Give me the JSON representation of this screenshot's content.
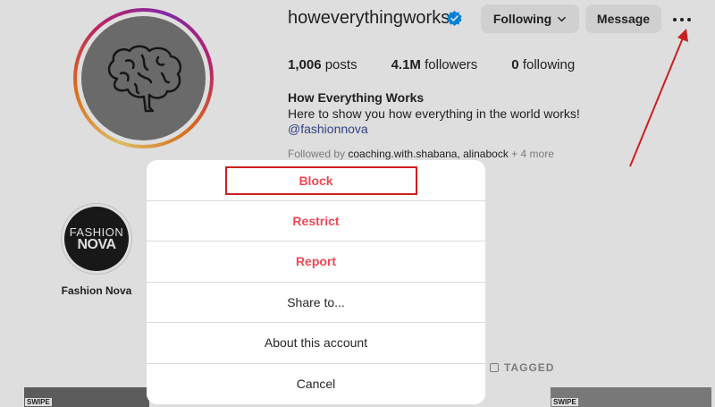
{
  "profile": {
    "username": "howeverythingworks",
    "following_button": "Following",
    "message_button": "Message",
    "stats": [
      {
        "value": "1,006",
        "label": "posts"
      },
      {
        "value": "4.1M",
        "label": "followers"
      },
      {
        "value": "0",
        "label": "following"
      }
    ],
    "bio": {
      "name": "How Everything Works",
      "text": "Here to show you how everything in the world works!",
      "link": "@fashionnova"
    },
    "followed_by": {
      "prefix": "Followed by ",
      "users": "coaching.with.shabana, alinabock",
      "more": " + 4 more"
    },
    "highlight": {
      "label": "Fashion Nova",
      "logo_line1": "FASHION",
      "logo_line2": "NOVA"
    },
    "tabs": {
      "tagged": "TAGGED"
    },
    "thumb_badge": "SWIPE"
  },
  "dialog": {
    "items": [
      {
        "label": "Block",
        "style": "danger"
      },
      {
        "label": "Restrict",
        "style": "danger"
      },
      {
        "label": "Report",
        "style": "danger"
      },
      {
        "label": "Share to...",
        "style": "normal"
      },
      {
        "label": "About this account",
        "style": "normal"
      },
      {
        "label": "Cancel",
        "style": "normal"
      }
    ]
  },
  "colors": {
    "danger": "#ed4956",
    "annotation": "#cc1f1f",
    "verified": "#0095f6",
    "link": "#3a4c9a"
  },
  "icons": [
    "brain-icon",
    "verified-badge-icon",
    "chevron-down-icon",
    "more-options-icon",
    "tag-icon"
  ]
}
